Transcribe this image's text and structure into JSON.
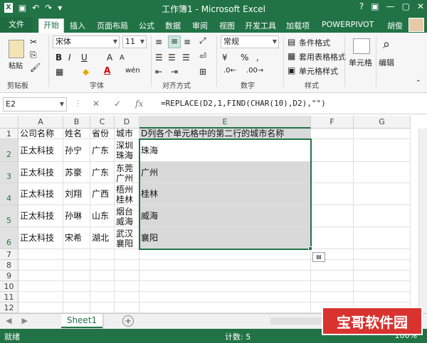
{
  "title_bar": {
    "window_title": "工作簿1 - Microsoft Excel",
    "qat": [
      "save-icon",
      "undo-icon",
      "redo-icon",
      "customize-icon"
    ],
    "window_buttons": [
      "?",
      "restore",
      "—",
      "▢",
      "✕"
    ]
  },
  "tabs": [
    "文件",
    "开始",
    "插入",
    "页面布局",
    "公式",
    "数据",
    "审阅",
    "视图",
    "开发工具",
    "加载项",
    "POWERPIVOT"
  ],
  "active_tab": "开始",
  "user": "胡俊",
  "ribbon": {
    "clipboard": {
      "paste": "粘贴",
      "label": "剪贴板"
    },
    "font": {
      "name": "宋体",
      "size": "11",
      "label": "字体",
      "bold": "B",
      "italic": "I",
      "underline": "U",
      "grow": "A",
      "shrink": "A",
      "wen": "wén"
    },
    "alignment": {
      "label": "对齐方式"
    },
    "number": {
      "format": "常规",
      "label": "数字",
      "percent": "%",
      "comma": ","
    },
    "styles": {
      "conditional": "条件格式",
      "table": "套用表格格式",
      "cell_style": "单元格样式",
      "label": "样式"
    },
    "cells": {
      "label": "单元格"
    },
    "editing": {
      "label": "编辑"
    }
  },
  "formula_bar": {
    "name_box": "E2",
    "formula": "=REPLACE(D2,1,FIND(CHAR(10),D2),\"\")",
    "cancel": "✕",
    "enter": "✓",
    "fx": "fx"
  },
  "grid": {
    "columns": [
      "A",
      "B",
      "C",
      "D",
      "E",
      "F",
      "G"
    ],
    "rows": [
      "1",
      "2",
      "3",
      "4",
      "5",
      "6",
      "7",
      "8",
      "9",
      "10",
      "11",
      "12"
    ],
    "header_row": [
      "公司名称",
      "姓名",
      "省份",
      "城市",
      "D列各个单元格中的第二行的城市名称"
    ],
    "data": [
      [
        "正太科技",
        "孙宁",
        "广东",
        "深圳\n珠海",
        "珠海"
      ],
      [
        "正太科技",
        "苏豪",
        "广东",
        "东莞\n广州",
        "广州"
      ],
      [
        "正太科技",
        "刘翔",
        "广西",
        "梧州\n桂林",
        "桂林"
      ],
      [
        "正太科技",
        "孙琳",
        "山东",
        "烟台\n威海",
        "威海"
      ],
      [
        "正太科技",
        "宋希",
        "湖北",
        "武汉\n襄阳",
        "襄阳"
      ]
    ]
  },
  "sheet": {
    "tab": "Sheet1",
    "add": "+",
    "nav": [
      "◀",
      "▶"
    ]
  },
  "status": {
    "ready": "就绪",
    "count": "计数: 5",
    "zoom": "100%"
  },
  "watermark": "宝哥软件园"
}
